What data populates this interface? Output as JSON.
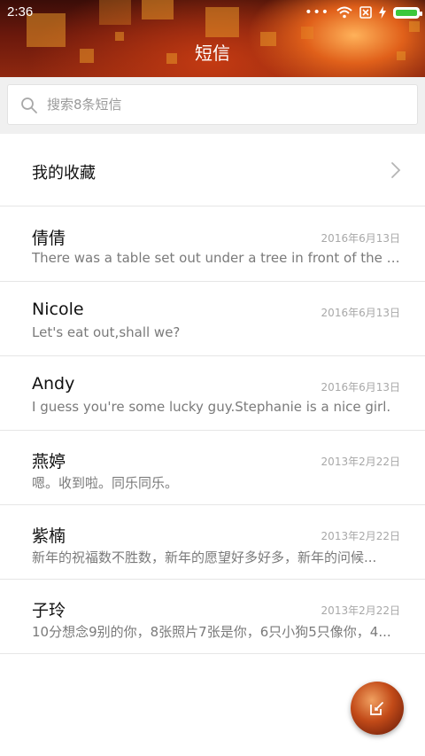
{
  "status_bar": {
    "time": "2:36"
  },
  "header": {
    "title": "短信"
  },
  "search": {
    "placeholder": "搜索8条短信"
  },
  "favorites": {
    "label": "我的收藏"
  },
  "messages": [
    {
      "name": "倩倩",
      "date": "2016年6月13日",
      "preview": "There was a table set out under a tree in front of the ho..."
    },
    {
      "name": "Nicole",
      "date": "2016年6月13日",
      "preview": "Let's eat out,shall we?"
    },
    {
      "name": "Andy",
      "date": "2016年6月13日",
      "preview": "I guess you're some lucky guy.Stephanie is a nice girl."
    },
    {
      "name": "燕婷",
      "date": "2013年2月22日",
      "preview": "嗯。收到啦。同乐同乐。"
    },
    {
      "name": "紫楠",
      "date": "2013年2月22日",
      "preview": "新年的祝福数不胜数，新年的愿望好多好多，新年的问候..."
    },
    {
      "name": "子玲",
      "date": "2013年2月22日",
      "preview": "10分想念9别的你，8张照片7张是你，6只小狗5只像你，4..."
    }
  ],
  "colors": {
    "accent": "#c24a18",
    "battery": "#3cc83c"
  },
  "icons": {
    "search": "search-icon",
    "chevron": "chevron-right-icon",
    "compose": "compose-icon"
  }
}
